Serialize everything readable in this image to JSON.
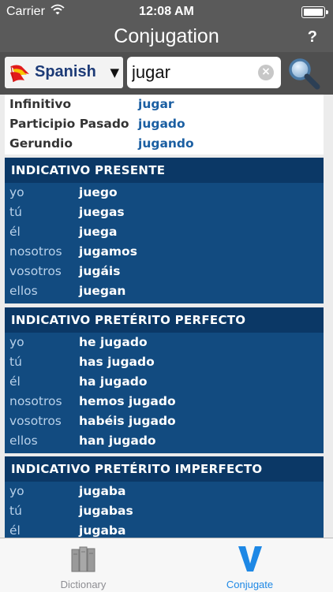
{
  "status_bar": {
    "carrier": "Carrier",
    "time": "12:08 AM"
  },
  "nav": {
    "title": "Conjugation",
    "help": "?"
  },
  "search": {
    "language": "Spanish",
    "query": "jugar"
  },
  "forms": [
    {
      "label": "Infinitivo",
      "value": "jugar"
    },
    {
      "label": "Participio Pasado",
      "value": "jugado"
    },
    {
      "label": "Gerundio",
      "value": "jugando"
    }
  ],
  "tenses": [
    {
      "title": "INDICATIVO PRESENTE",
      "rows": [
        {
          "p": "yo",
          "v": "juego"
        },
        {
          "p": "tú",
          "v": "juegas"
        },
        {
          "p": "él",
          "v": "juega"
        },
        {
          "p": "nosotros",
          "v": "jugamos"
        },
        {
          "p": "vosotros",
          "v": "jugáis"
        },
        {
          "p": "ellos",
          "v": "juegan"
        }
      ]
    },
    {
      "title": "INDICATIVO PRETÉRITO PERFECTO",
      "rows": [
        {
          "p": "yo",
          "v": "he jugado"
        },
        {
          "p": "tú",
          "v": "has jugado"
        },
        {
          "p": "él",
          "v": "ha jugado"
        },
        {
          "p": "nosotros",
          "v": "hemos jugado"
        },
        {
          "p": "vosotros",
          "v": "habéis jugado"
        },
        {
          "p": "ellos",
          "v": "han jugado"
        }
      ]
    },
    {
      "title": "INDICATIVO PRETÉRITO IMPERFECTO",
      "rows": [
        {
          "p": "yo",
          "v": "jugaba"
        },
        {
          "p": "tú",
          "v": "jugabas"
        },
        {
          "p": "él",
          "v": "jugaba"
        }
      ]
    }
  ],
  "tabs": [
    {
      "label": "Dictionary",
      "icon": "books-icon",
      "active": false
    },
    {
      "label": "Conjugate",
      "icon": "v-icon",
      "active": true
    }
  ],
  "colors": {
    "accent": "#1e88e5",
    "tense_header": "#0b3866",
    "tense_body": "#124b80",
    "bar": "#5a5a5a"
  }
}
